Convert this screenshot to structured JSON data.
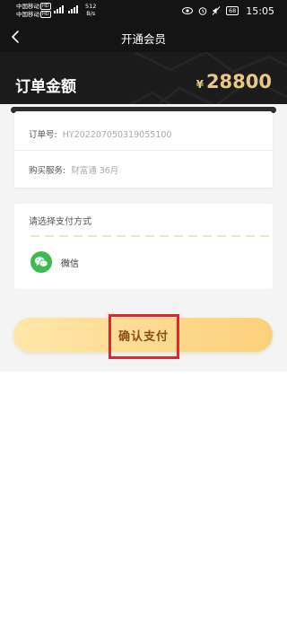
{
  "status_bar": {
    "carrier_1": "中国移动",
    "carrier_2": "中国移动",
    "hd_label": "HD",
    "net_speed_value": "512",
    "net_speed_unit": "B/s",
    "battery": "68",
    "time": "15:05"
  },
  "nav": {
    "title": "开通会员"
  },
  "header": {
    "amount_label": "订单金额",
    "currency_symbol": "¥",
    "amount": "28800",
    "amount_color": "#e9c886"
  },
  "order": {
    "order_no_label": "订单号:",
    "order_no_value": "HY202207050319055100",
    "service_label": "购买服务:",
    "service_value": "财富通 36月"
  },
  "payment": {
    "title": "请选择支付方式",
    "methods": [
      {
        "label": "微信",
        "icon": "wechat-icon",
        "color": "#3dba53"
      }
    ]
  },
  "confirm": {
    "label": "确认支付",
    "highlight_color": "#e0252b"
  }
}
